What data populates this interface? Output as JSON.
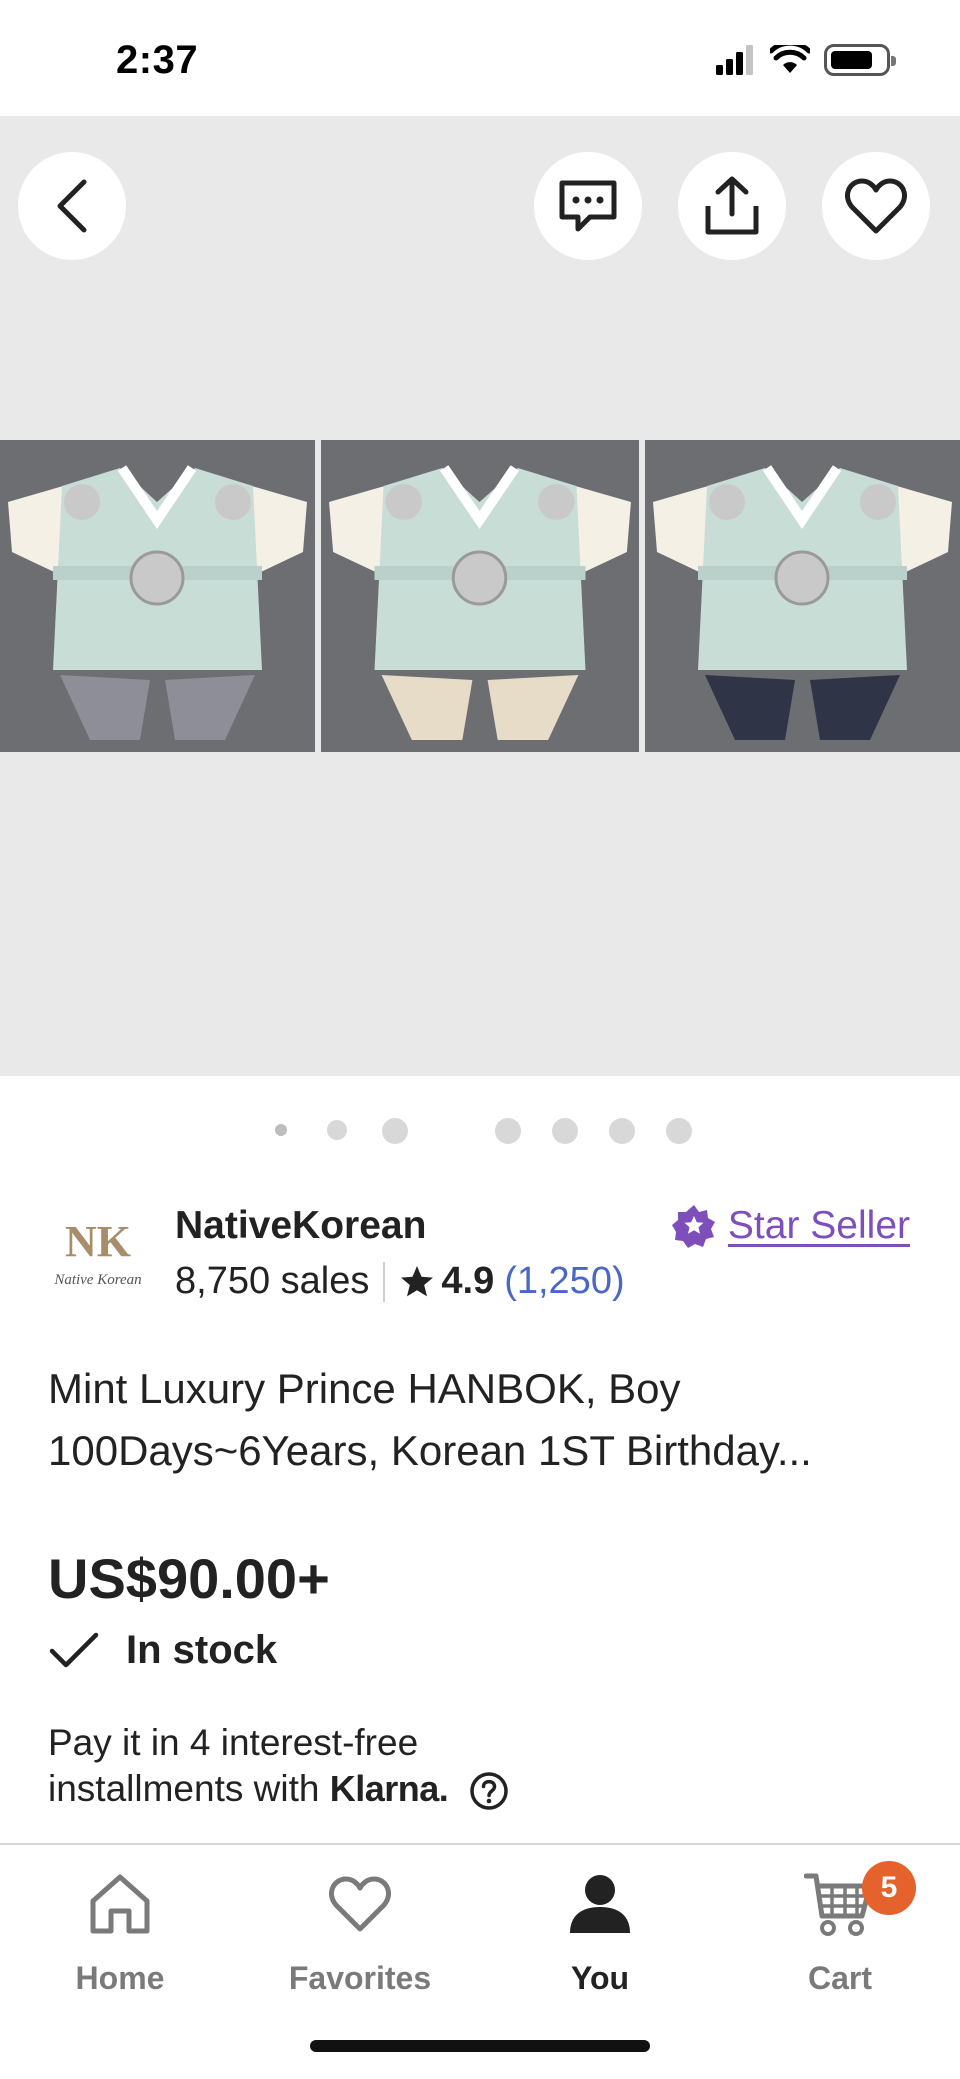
{
  "status_bar": {
    "time": "2:37"
  },
  "gallery": {
    "actions": [
      "back-icon",
      "message-icon",
      "share-icon",
      "favorite-icon"
    ],
    "photos": [
      {
        "garment": "mint",
        "pants_color": "#8d8e98"
      },
      {
        "garment": "mint",
        "pants_color": "#e6dcc8"
      },
      {
        "garment": "mint",
        "pants_color": "#2f3447"
      }
    ],
    "page_dots": 7,
    "active_dot": 0
  },
  "shop": {
    "logo_initials": "NK",
    "logo_script": "Native Korean",
    "name": "NativeKorean",
    "badge": "Star Seller",
    "sales": "8,750 sales",
    "rating": "4.9",
    "review_count": "(1,250)"
  },
  "product": {
    "title_line1": "Mint Luxury Prince HANBOK, Boy",
    "title_line2": "100Days~6Years, Korean 1ST Birthday...",
    "price": "US$90.00+",
    "stock": "In stock"
  },
  "klarna": {
    "line1": "Pay it in 4 interest-free",
    "line2_prefix": "installments with",
    "brand": "Klarna."
  },
  "tabs": [
    {
      "label": "Home",
      "icon": "home-icon",
      "active": false
    },
    {
      "label": "Favorites",
      "icon": "heart-icon",
      "active": false
    },
    {
      "label": "You",
      "icon": "person-icon",
      "active": true
    },
    {
      "label": "Cart",
      "icon": "cart-icon",
      "active": false,
      "badge": "5"
    }
  ],
  "colors": {
    "star_seller": "#7e4fbb",
    "review_link": "#4a67c8",
    "cart_badge": "#e5622c",
    "gallery_bg": "#e9e9e9"
  }
}
